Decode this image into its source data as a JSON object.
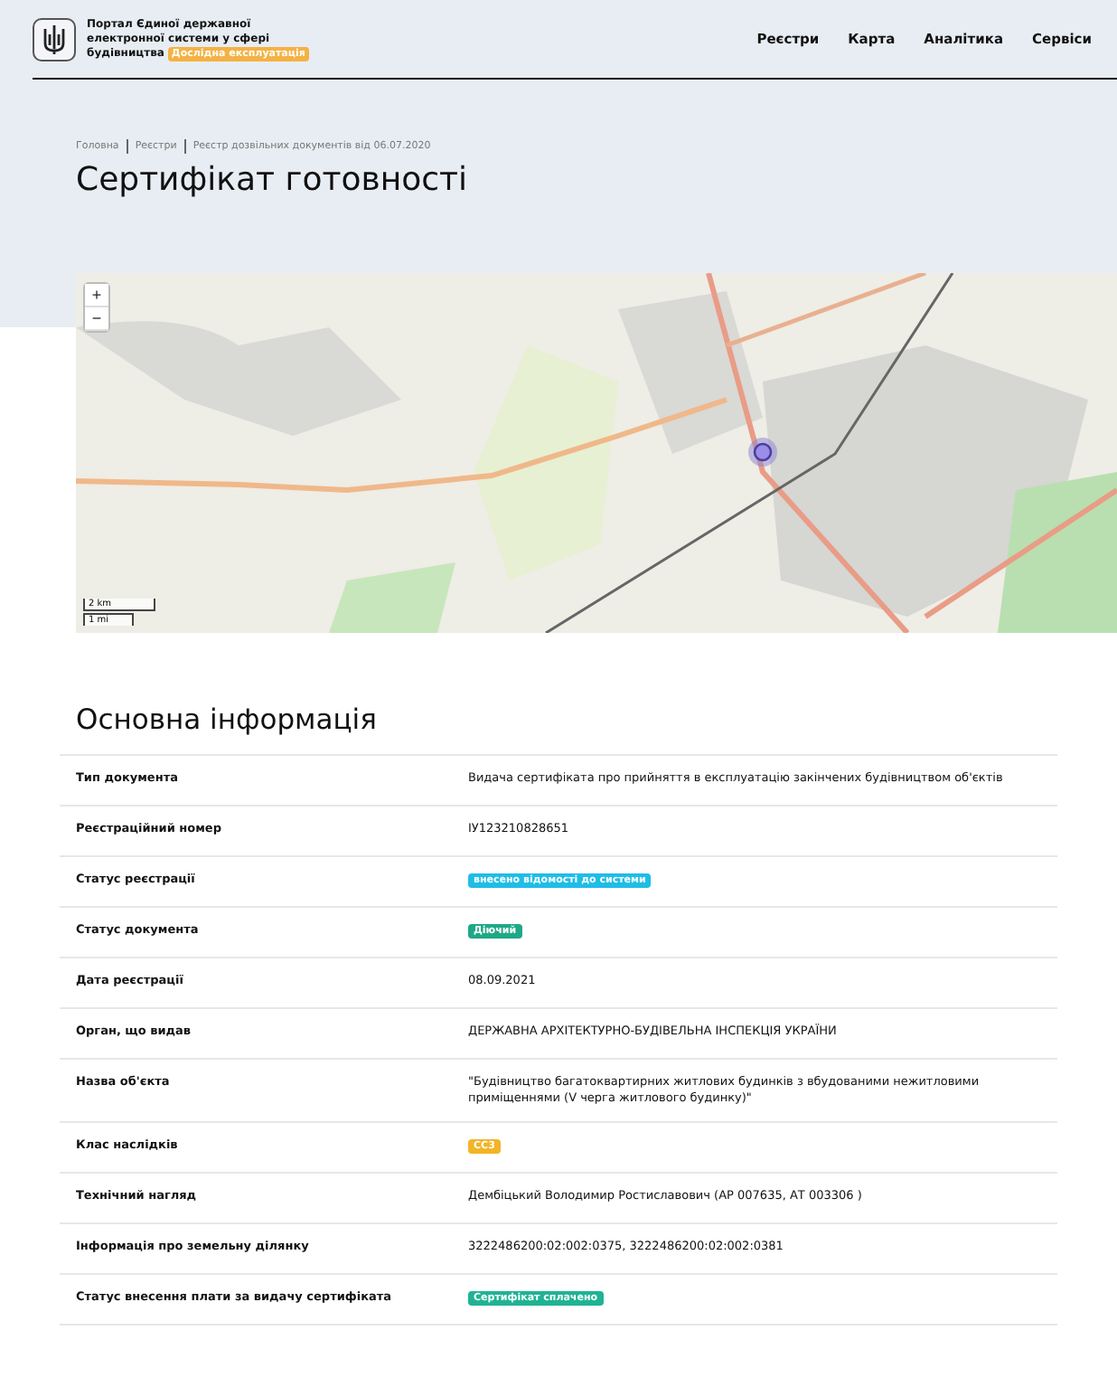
{
  "header": {
    "portal_title": [
      "Портал Єдиної державної",
      "електронної системи у сфері",
      "будівництва"
    ],
    "badge": "Дослідна експлуатація",
    "nav": [
      "Реєстри",
      "Карта",
      "Аналітика",
      "Сервіси"
    ]
  },
  "breadcrumbs": [
    "Головна",
    "Реєстри",
    "Реєстр дозвільних документів від 06.07.2020"
  ],
  "page_title": "Сертифікат готовності",
  "map": {
    "zoom_in": "+",
    "zoom_out": "−",
    "scale": [
      "2 km",
      "1 mi"
    ]
  },
  "section_title": "Основна інформація",
  "rows": [
    {
      "label": "Тип документа",
      "kind": "text",
      "value": "Видача сертифіката про прийняття в експлуатацію закінчених будівництвом об'єктів"
    },
    {
      "label": "Реєстраційний номер",
      "kind": "text",
      "value": "ІУ123210828651"
    },
    {
      "label": "Статус реєстрації",
      "kind": "badge",
      "value": "внесено відомості до системи",
      "color": "#1fbde6"
    },
    {
      "label": "Статус документа",
      "kind": "badge",
      "value": "Діючий",
      "color": "#1fa886"
    },
    {
      "label": "Дата реєстрації",
      "kind": "text",
      "value": "08.09.2021"
    },
    {
      "label": "Орган, що видав",
      "kind": "text",
      "value": "ДЕРЖАВНА АРХІТЕКТУРНО-БУДІВЕЛЬНА ІНСПЕКЦІЯ УКРАЇНИ"
    },
    {
      "label": "Назва об'єкта",
      "kind": "text",
      "value": "\"Будівництво багатоквартирних житлових будинків з вбудованими нежитловими приміщеннями (V черга житлового будинку)\""
    },
    {
      "label": "Клас наслідків",
      "kind": "badge",
      "value": "СС3",
      "color": "#f2b428"
    },
    {
      "label": "Технічний нагляд",
      "kind": "text",
      "value": "Дембіцький Володимир Ростиславович (АР 007635, АТ 003306 )"
    },
    {
      "label": "Інформація про земельну ділянку",
      "kind": "text",
      "value": "3222486200:02:002:0375, 3222486200:02:002:0381"
    },
    {
      "label": "Статус внесення плати за видачу сертифіката",
      "kind": "badge",
      "value": "Сертифікат сплачено",
      "color": "#1fb394"
    }
  ]
}
